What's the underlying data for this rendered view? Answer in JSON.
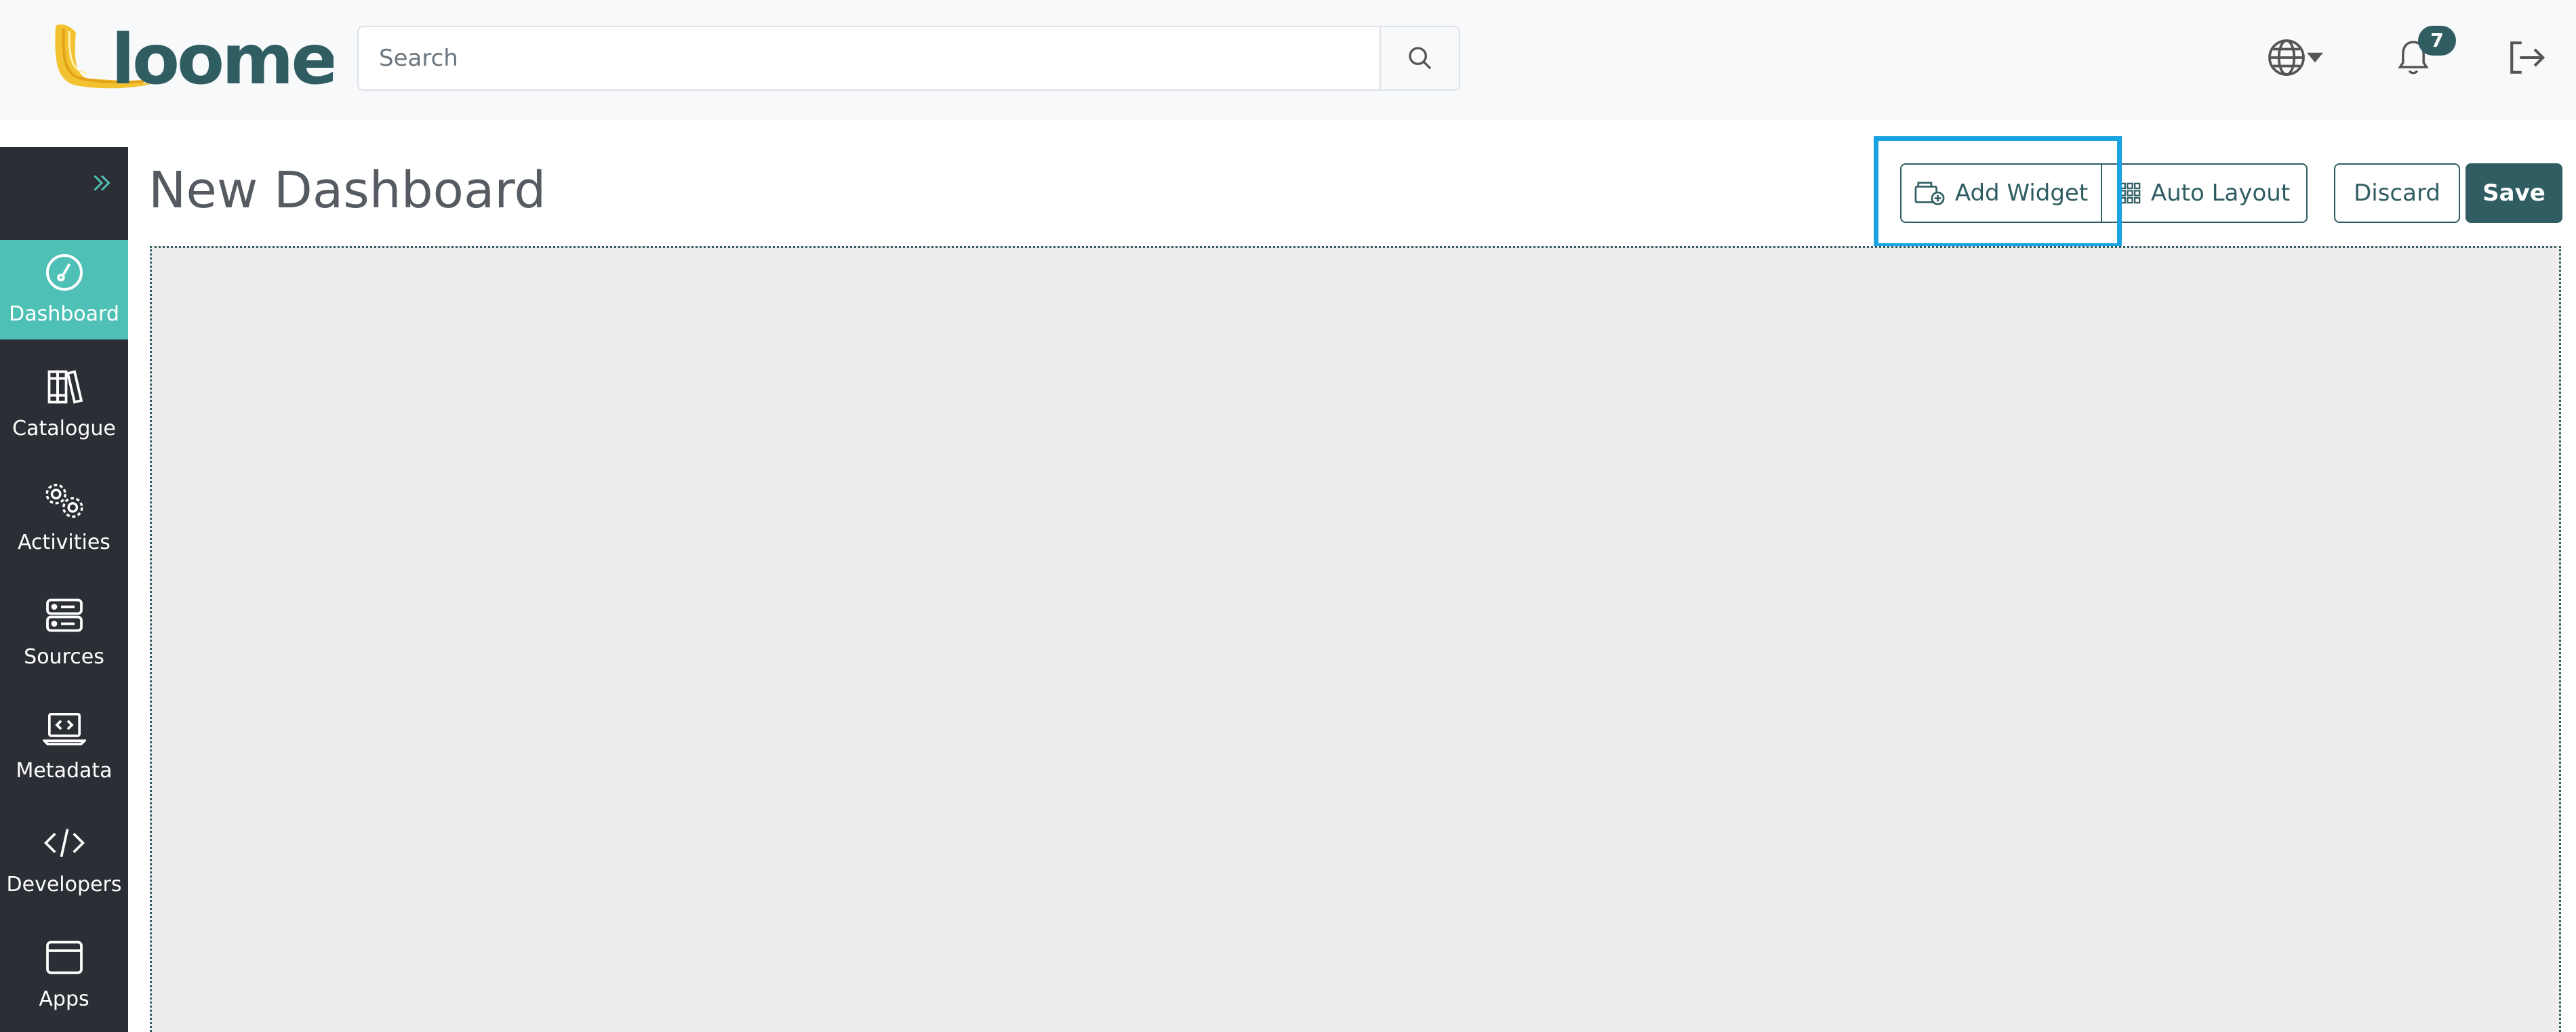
{
  "brand": {
    "logo_text": "loome",
    "accent_color": "#2f5d62",
    "active_color": "#4ec0b5",
    "logo_gold": "#f2c230"
  },
  "topbar": {
    "search_placeholder": "Search",
    "search_icon": "search-icon",
    "language_icon": "globe-icon",
    "notifications_count": "7",
    "logout_icon": "logout-icon"
  },
  "sidebar": {
    "expand_icon": "chevron-double-right-icon",
    "items": [
      {
        "label": "Dashboard",
        "icon": "gauge-icon",
        "active": true
      },
      {
        "label": "Catalogue",
        "icon": "books-icon",
        "active": false
      },
      {
        "label": "Activities",
        "icon": "gears-icon",
        "active": false
      },
      {
        "label": "Sources",
        "icon": "server-icon",
        "active": false
      },
      {
        "label": "Metadata",
        "icon": "code-laptop-icon",
        "active": false
      },
      {
        "label": "Developers",
        "icon": "code-icon",
        "active": false
      },
      {
        "label": "Apps",
        "icon": "window-icon",
        "active": false
      }
    ]
  },
  "main": {
    "title": "New Dashboard",
    "buttons": {
      "add_widget": "Add Widget",
      "auto_layout": "Auto Layout",
      "discard": "Discard",
      "save": "Save"
    },
    "highlight_color": "#1aa3e0"
  }
}
